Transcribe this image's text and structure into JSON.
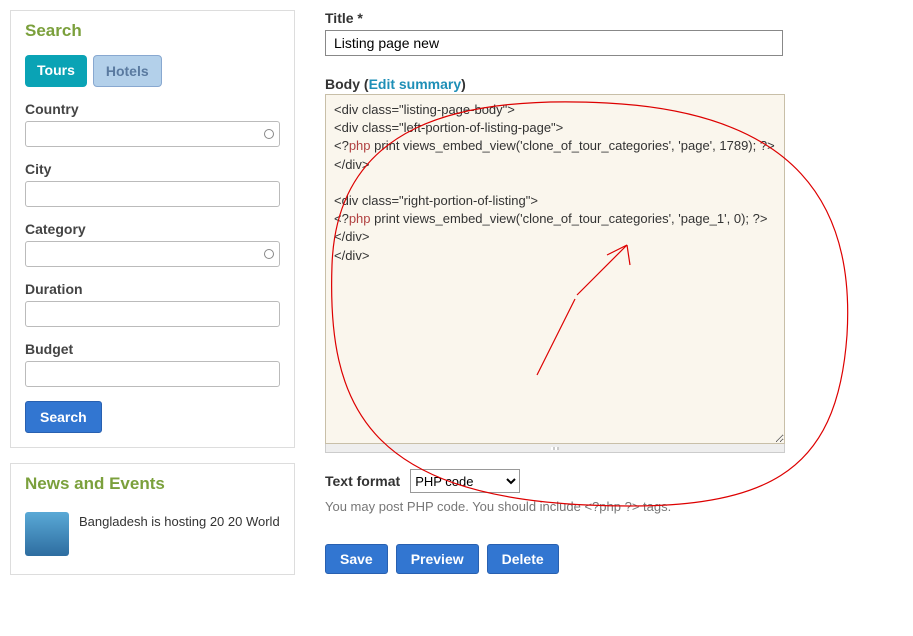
{
  "sidebar": {
    "search_title": "Search",
    "tabs": {
      "tours": "Tours",
      "hotels": "Hotels"
    },
    "fields": {
      "country": "Country",
      "city": "City",
      "category": "Category",
      "duration": "Duration",
      "budget": "Budget"
    },
    "search_button": "Search",
    "news_title": "News and Events",
    "news_item_text": "Bangladesh is hosting 20 20 World"
  },
  "main": {
    "title_label": "Title *",
    "title_value": "Listing page new",
    "body_label": "Body (",
    "edit_summary": "Edit summary",
    "body_label_close": ")",
    "body_text": "<div class=\"listing-page-body\">\n<div class=\"left-portion-of-listing-page\">\n<?php print views_embed_view('clone_of_tour_categories', 'page', 1789); ?>\n</div>\n\n<div class=\"right-portion-of-listing\">\n<?php print views_embed_view('clone_of_tour_categories', 'page_1', 0); ?>\n</div>\n</div>",
    "text_format_label": "Text format",
    "text_format_value": "PHP code",
    "format_hint": "You may post PHP code. You should include <?php ?> tags.",
    "buttons": {
      "save": "Save",
      "preview": "Preview",
      "delete": "Delete"
    }
  }
}
